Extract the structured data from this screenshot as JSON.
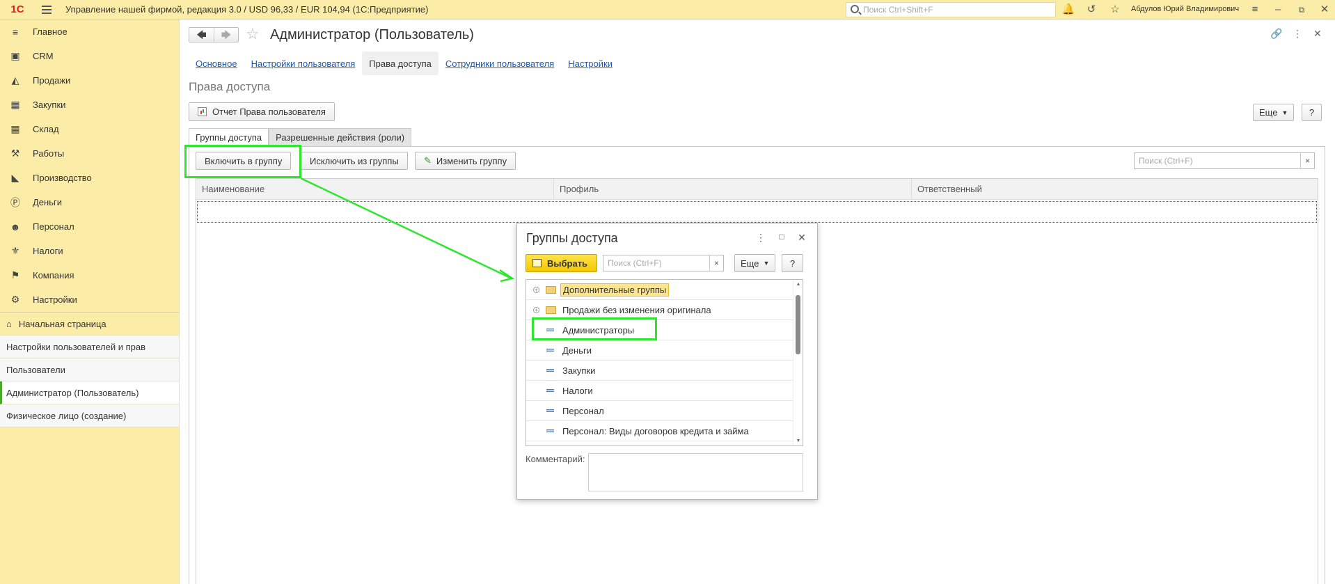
{
  "topbar": {
    "logo": "1С",
    "title": "Управление нашей фирмой, редакция 3.0 / USD 96,33 / EUR 104,94  (1С:Предприятие)",
    "search_placeholder": "Поиск Ctrl+Shift+F",
    "user": "Абдулов Юрий Владимирович",
    "icons": [
      "bell-icon",
      "history-icon",
      "star-icon",
      "menu-icon",
      "minimize-icon",
      "restore-icon",
      "close-icon"
    ]
  },
  "sidebar": {
    "sections": [
      {
        "label": "Главное",
        "icon": "menu-icon"
      },
      {
        "label": "CRM",
        "icon": "crm-icon"
      },
      {
        "label": "Продажи",
        "icon": "basket-icon"
      },
      {
        "label": "Закупки",
        "icon": "cart-icon"
      },
      {
        "label": "Склад",
        "icon": "warehouse-icon"
      },
      {
        "label": "Работы",
        "icon": "tools-icon"
      },
      {
        "label": "Производство",
        "icon": "factory-icon"
      },
      {
        "label": "Деньги",
        "icon": "coin-icon"
      },
      {
        "label": "Персонал",
        "icon": "people-icon"
      },
      {
        "label": "Налоги",
        "icon": "emblem-icon"
      },
      {
        "label": "Компания",
        "icon": "flag-icon"
      },
      {
        "label": "Настройки",
        "icon": "gear-icon"
      }
    ],
    "nav": [
      {
        "label": "Начальная страница",
        "icon": "home-icon"
      },
      {
        "label": "Настройки пользователей и прав"
      },
      {
        "label": "Пользователи"
      },
      {
        "label": "Администратор (Пользователь)",
        "active": true
      },
      {
        "label": "Физическое лицо (создание)"
      }
    ]
  },
  "form": {
    "title": "Администратор (Пользователь)",
    "tabs": [
      "Основное",
      "Настройки пользователя",
      "Права доступа",
      "Сотрудники пользователя",
      "Настройки"
    ],
    "active_tab": "Права доступа",
    "section_title": "Права доступа",
    "report_button": "Отчет Права пользователя",
    "more_button": "Еще",
    "help_button": "?",
    "subtabs": [
      "Группы доступа",
      "Разрешенные действия (роли)"
    ],
    "toolbar": {
      "include": "Включить в группу",
      "exclude": "Исключить из группы",
      "change": "Изменить группу",
      "search_placeholder": "Поиск (Ctrl+F)",
      "clear": "×"
    },
    "columns": [
      "Наименование",
      "Профиль",
      "Ответственный"
    ]
  },
  "dialog": {
    "title": "Группы доступа",
    "select_button": "Выбрать",
    "search_placeholder": "Поиск (Ctrl+F)",
    "clear": "×",
    "more_button": "Еще",
    "help_button": "?",
    "items": [
      {
        "label": "Дополнительные группы",
        "type": "folder",
        "selected": true
      },
      {
        "label": "Продажи без изменения оригинала",
        "type": "folder"
      },
      {
        "label": "Администраторы",
        "type": "item"
      },
      {
        "label": "Деньги",
        "type": "item"
      },
      {
        "label": "Закупки",
        "type": "item"
      },
      {
        "label": "Налоги",
        "type": "item"
      },
      {
        "label": "Персонал",
        "type": "item"
      },
      {
        "label": "Персонал: Виды договоров кредита и займа",
        "type": "item"
      }
    ],
    "comment_label": "Комментарий:"
  },
  "annotation_color": "#2ee62e"
}
